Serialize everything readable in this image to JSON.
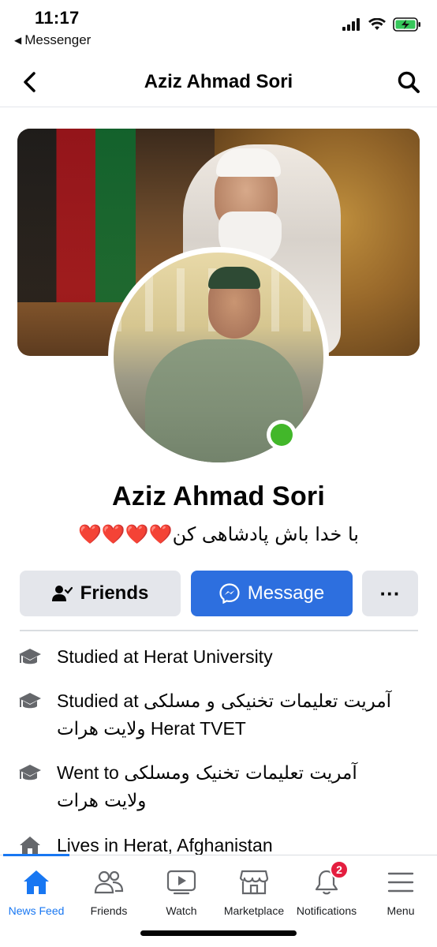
{
  "status_bar": {
    "time": "11:17",
    "back_app": "Messenger",
    "icons": [
      "signal-icon",
      "wifi-icon",
      "battery-charging-icon"
    ]
  },
  "nav": {
    "title": "Aziz Ahmad Sori",
    "back_icon": "chevron-left-icon",
    "search_icon": "search-icon"
  },
  "profile": {
    "name": "Aziz Ahmad Sori",
    "bio_text": "با خدا باش پادشاهی کن",
    "bio_hearts": "❤️❤️❤️❤️",
    "online": true,
    "online_color": "#42b72a"
  },
  "actions": {
    "friends_label": "Friends",
    "message_label": "Message",
    "more_label": "···",
    "message_color": "#2d6fdf"
  },
  "details": [
    {
      "icon": "graduation-cap-icon",
      "prefix": "Studied at ",
      "rtl": "",
      "value": "Herat University"
    },
    {
      "icon": "graduation-cap-icon",
      "prefix": "Studied at ",
      "rtl": "آمریت تعلیمات تخنیکی و مسلکی",
      "value": "ولایت هرات Herat TVET"
    },
    {
      "icon": "graduation-cap-icon",
      "prefix": "Went to ",
      "rtl": "آمریت تعلیمات تخنیک ومسلکی",
      "value": "ولایت هرات"
    },
    {
      "icon": "home-icon",
      "prefix": "Lives in ",
      "rtl": "",
      "value": "Herat, Afghanistan"
    }
  ],
  "tabbar": {
    "tabs": [
      {
        "label": "News Feed",
        "icon": "home-icon",
        "active": true
      },
      {
        "label": "Friends",
        "icon": "friends-icon",
        "active": false
      },
      {
        "label": "Watch",
        "icon": "watch-icon",
        "active": false
      },
      {
        "label": "Marketplace",
        "icon": "marketplace-icon",
        "active": false
      },
      {
        "label": "Notifications",
        "icon": "bell-icon",
        "active": false,
        "badge": "2"
      },
      {
        "label": "Menu",
        "icon": "menu-icon",
        "active": false
      }
    ],
    "active_color": "#1877f2"
  }
}
